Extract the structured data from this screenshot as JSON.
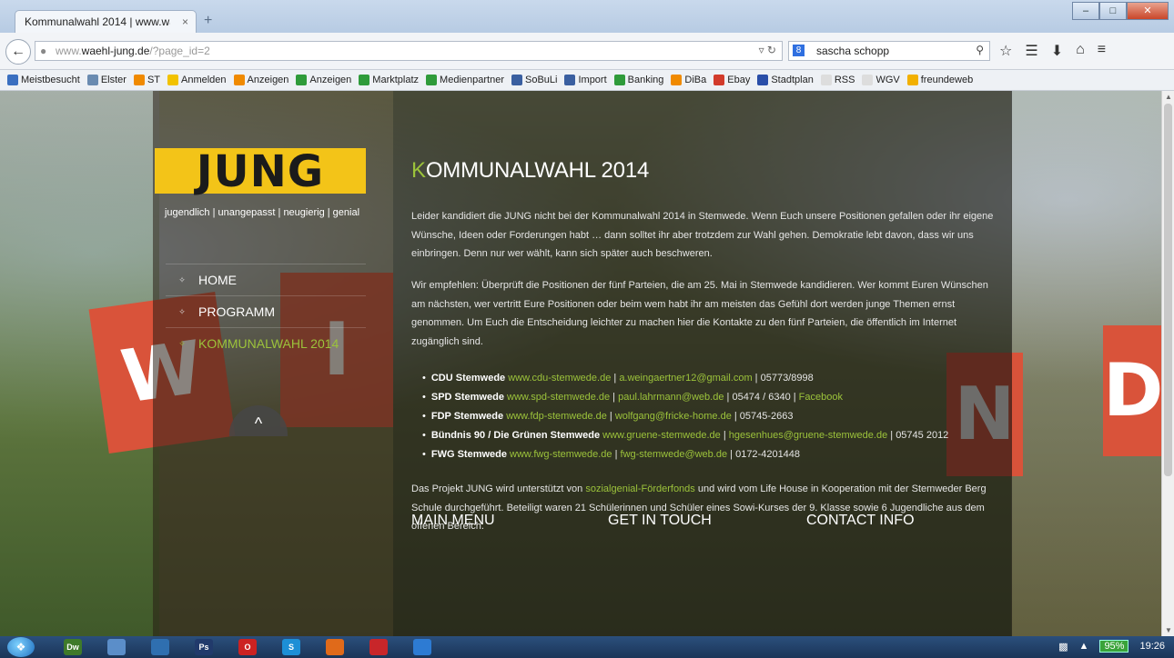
{
  "browser": {
    "tab_title": "Kommunalwahl 2014 | www.wa...",
    "tab_close": "×",
    "new_tab": "+",
    "url_prefix": "www.",
    "url_domain": "waehl-jung.de",
    "url_path": "/?page_id=2",
    "search_engine_glyph": "8",
    "search_text": "sascha schopp",
    "window_buttons": [
      "‒",
      "□",
      "✕"
    ]
  },
  "bookmarks": [
    {
      "label": "Meistbesucht",
      "color": "#3a6fc0"
    },
    {
      "label": "Elster",
      "color": "#6a8bb0"
    },
    {
      "label": "ST",
      "color": "#f08a00"
    },
    {
      "label": "Anmelden",
      "color": "#f2c200"
    },
    {
      "label": "Anzeigen",
      "color": "#f08a00"
    },
    {
      "label": "Anzeigen",
      "color": "#2f9b3a"
    },
    {
      "label": "Marktplatz",
      "color": "#2f9b3a"
    },
    {
      "label": "Medienpartner",
      "color": "#2f9b3a"
    },
    {
      "label": "SoBuLi",
      "color": "#3a5fa0"
    },
    {
      "label": "Import",
      "color": "#3a5fa0"
    },
    {
      "label": "Banking",
      "color": "#2f9b3a"
    },
    {
      "label": "DiBa",
      "color": "#f08a00"
    },
    {
      "label": "Ebay",
      "color": "#d23b2b"
    },
    {
      "label": "Stadtplan",
      "color": "#2a4ea8"
    },
    {
      "label": "RSS",
      "color": "#dddddd"
    },
    {
      "label": "WGV",
      "color": "#dddddd"
    },
    {
      "label": "freundeweb",
      "color": "#f2b000"
    }
  ],
  "site": {
    "logo": "JUNG",
    "tagline": "jugendlich | unangepasst | neugierig | genial",
    "menu": [
      {
        "label": "HOME",
        "active": false
      },
      {
        "label": "PROGRAMM",
        "active": false
      },
      {
        "label": "KOMMUNALWAHL 2014",
        "active": true
      }
    ],
    "back_to_top": "^",
    "title_first": "K",
    "title_rest": "OMMUNALWAHL 2014",
    "intro": "Leider kandidiert die JUNG nicht bei der Kommunalwahl 2014 in Stemwede. Wenn Euch unsere Positionen gefallen oder ihr eigene Wünsche, Ideen oder Forderungen habt … dann solltet ihr aber trotzdem zur Wahl gehen. Demokratie lebt davon, dass wir uns einbringen. Denn nur wer wählt, kann sich später auch beschweren.",
    "recommend": "Wir empfehlen: Überprüft die Positionen der fünf Parteien, die am 25. Mai in Stemwede kandidieren. Wer kommt Euren Wünschen am nächsten, wer vertritt Eure Positionen oder beim wem habt ihr am meisten das Gefühl dort werden junge Themen ernst genommen. Um Euch die Entscheidung leichter zu machen hier die Kontakte zu den fünf Parteien, die öffentlich im Internet zugänglich sind.",
    "parties": [
      {
        "name": "CDU Stemwede",
        "web": "www.cdu-stemwede.de",
        "mail": "a.weingaertner12@gmail.com",
        "phone": "05773/8998",
        "extra": ""
      },
      {
        "name": "SPD Stemwede",
        "web": "www.spd-stemwede.de",
        "mail": "paul.lahrmann@web.de",
        "phone": "05474 / 6340",
        "extra": "Facebook"
      },
      {
        "name": "FDP Stemwede",
        "web": "www.fdp-stemwede.de",
        "mail": "wolfgang@fricke-home.de",
        "phone": "05745-2663",
        "extra": ""
      },
      {
        "name": "Bündnis 90 / Die Grünen Stemwede",
        "web": "www.gruene-stemwede.de",
        "mail": "hgesenhues@gruene-stemwede.de",
        "phone": "05745 2012",
        "extra": ""
      },
      {
        "name": "FWG Stemwede",
        "web": "www.fwg-stemwede.de",
        "mail": "fwg-stemwede@web.de",
        "phone": "0172-4201448",
        "extra": ""
      }
    ],
    "project_before": "Das Projekt JUNG wird unterstützt von ",
    "project_link": "sozialgenial-Förderfonds",
    "project_after": " und wird vom Life House in Kooperation mit der Stemweder Berg Schule durchgeführt. Beteiligt waren 21 Schülerinnen und Schüler eines Sowi-Kurses der 9. Klasse sowie 6 Jugendliche aus dem offenen Bereich.",
    "footer": [
      "MAIN MENU",
      "GET IN TOUCH",
      "CONTACT INFO"
    ],
    "background_letters": [
      "W",
      "I",
      "N",
      "D"
    ]
  },
  "taskbar": {
    "apps": [
      {
        "label": "Dw",
        "color": "#3f7a2a"
      },
      {
        "label": "",
        "color": "#5b8ec9"
      },
      {
        "label": "",
        "color": "#2f6fb0"
      },
      {
        "label": "Ps",
        "color": "#213a6b"
      },
      {
        "label": "O",
        "color": "#c22"
      },
      {
        "label": "S",
        "color": "#1d8fd6"
      },
      {
        "label": "",
        "color": "#e06a1a"
      },
      {
        "label": "",
        "color": "#c8262a"
      },
      {
        "label": "",
        "color": "#2d7bd3"
      }
    ],
    "battery": "95%",
    "time": "19:26"
  }
}
